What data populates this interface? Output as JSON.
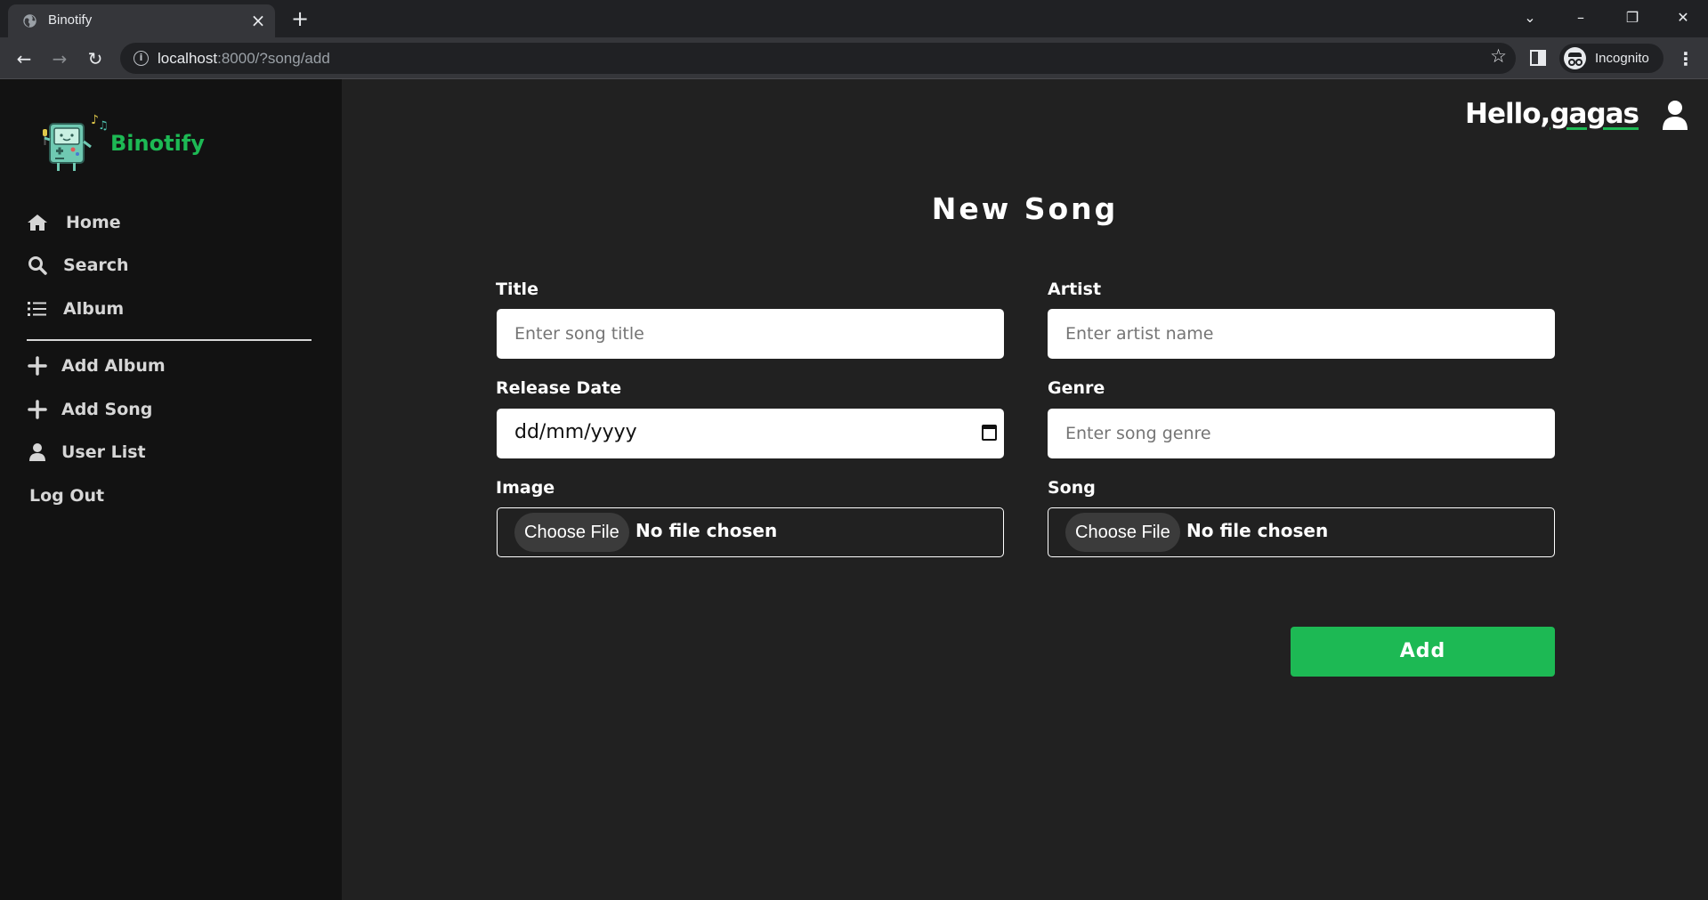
{
  "browser": {
    "tab_title": "Binotify",
    "url_host": "localhost",
    "url_rest": ":8000/?song/add",
    "profile_label": "Incognito"
  },
  "sidebar": {
    "brand": "Binotify",
    "nav": [
      {
        "label": "Home",
        "icon": "home-icon"
      },
      {
        "label": "Search",
        "icon": "search-icon"
      },
      {
        "label": "Album",
        "icon": "list-icon"
      }
    ],
    "actions": [
      {
        "label": "Add Album",
        "icon": "plus-icon"
      },
      {
        "label": "Add Song",
        "icon": "plus-icon"
      },
      {
        "label": "User List",
        "icon": "user-icon"
      }
    ],
    "logout": "Log Out"
  },
  "header": {
    "greeting": "Hello,",
    "username": "gagas"
  },
  "form": {
    "title": "New Song",
    "title_label": "Title",
    "title_placeholder": "Enter song title",
    "artist_label": "Artist",
    "artist_placeholder": "Enter artist name",
    "release_label": "Release Date",
    "release_value": "dd/mm/yyyy",
    "genre_label": "Genre",
    "genre_placeholder": "Enter song genre",
    "image_label": "Image",
    "song_label": "Song",
    "choose_file": "Choose File",
    "no_file": "No file chosen",
    "submit": "Add"
  },
  "colors": {
    "accent": "#1db954",
    "sidebar_bg": "#121212",
    "main_bg": "#212121"
  }
}
